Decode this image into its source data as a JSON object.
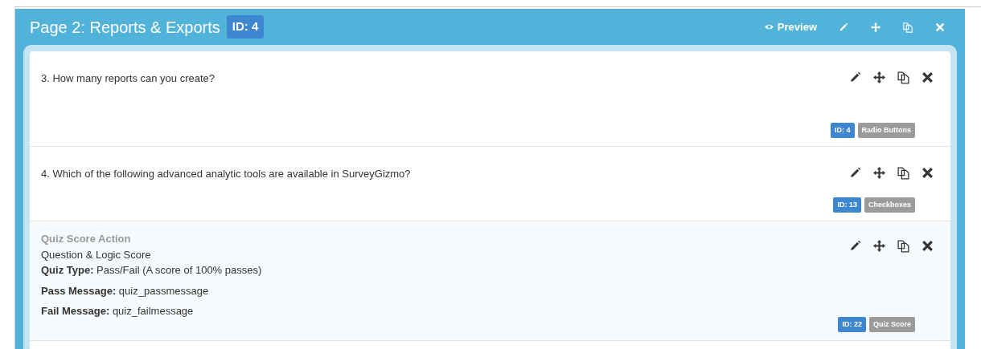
{
  "page": {
    "title": "Page 2: Reports & Exports",
    "id_badge": "ID: 4",
    "preview_label": "Preview"
  },
  "items": [
    {
      "kind": "question",
      "text": "3. How many reports can you create?",
      "id_badge": "ID: 4",
      "type_badge": "Radio Buttons"
    },
    {
      "kind": "question",
      "text": "4. Which of the following advanced analytic tools are available in SurveyGizmo?",
      "id_badge": "ID: 13",
      "type_badge": "Checkboxes"
    },
    {
      "kind": "action",
      "heading": "Quiz Score Action",
      "subtitle": "Question & Logic Score",
      "details": [
        {
          "label": "Quiz Type:",
          "value": "Pass/Fail (A score of 100% passes)"
        },
        {
          "label": "Pass Message:",
          "value": "quiz_passmessage"
        },
        {
          "label": "Fail Message:",
          "value": "quiz_failmessage"
        }
      ],
      "id_badge": "ID: 22",
      "type_badge": "Quiz Score"
    }
  ]
}
